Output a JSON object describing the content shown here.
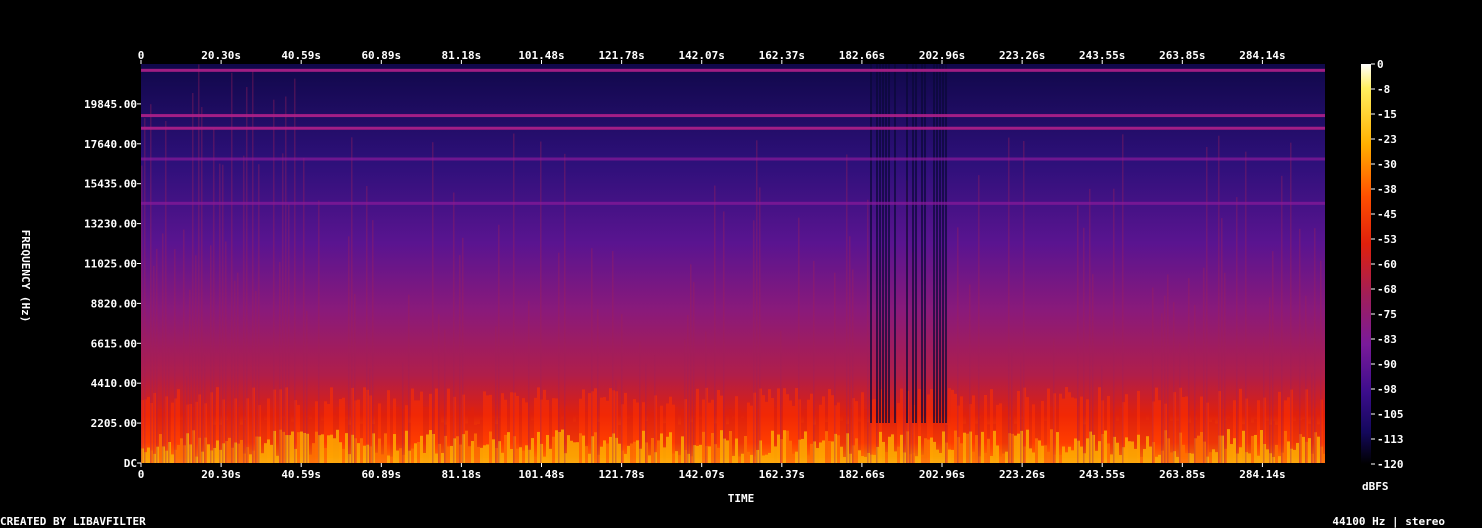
{
  "chart_data": {
    "type": "heatmap",
    "title": "",
    "xlabel": "TIME",
    "ylabel": "FREQUENCY (Hz)",
    "x_ticks": [
      "0",
      "20.30s",
      "40.59s",
      "60.89s",
      "81.18s",
      "101.48s",
      "121.78s",
      "142.07s",
      "162.37s",
      "182.66s",
      "202.96s",
      "223.26s",
      "243.55s",
      "263.85s",
      "284.14s"
    ],
    "x_tick_values": [
      0,
      20.3,
      40.59,
      60.89,
      81.18,
      101.48,
      121.78,
      142.07,
      162.37,
      182.66,
      202.96,
      223.26,
      243.55,
      263.85,
      284.14
    ],
    "xlim": [
      0,
      300
    ],
    "y_ticks": [
      "DC",
      "2205.00",
      "4410.00",
      "6615.00",
      "8820.00",
      "11025.00",
      "13230.00",
      "15435.00",
      "17640.00",
      "19845.00"
    ],
    "y_tick_values": [
      0,
      2205,
      4410,
      6615,
      8820,
      11025,
      13230,
      15435,
      17640,
      19845
    ],
    "ylim": [
      0,
      22050
    ],
    "colorbar": {
      "label": "dBFS",
      "ticks": [
        "0",
        "-8",
        "-15",
        "-23",
        "-30",
        "-38",
        "-45",
        "-53",
        "-60",
        "-68",
        "-75",
        "-83",
        "-90",
        "-98",
        "-105",
        "-113",
        "-120"
      ],
      "range": [
        -120,
        0
      ]
    },
    "grid": false,
    "colormap": [
      "#000000",
      "#1a0a5c",
      "#3c0d8c",
      "#7a1a9a",
      "#b01e5a",
      "#e0200c",
      "#ff6a00",
      "#ffb000",
      "#fff060",
      "#ffffff"
    ],
    "features": {
      "tonal_lines_hz": [
        21700,
        19200,
        18500,
        16800,
        14350
      ],
      "bright_band_max_hz": 3500,
      "quiet_segments_s": [
        [
          183,
          205
        ]
      ]
    }
  },
  "footer": {
    "left": "CREATED BY LIBAVFILTER",
    "right": "44100 Hz | stereo"
  }
}
